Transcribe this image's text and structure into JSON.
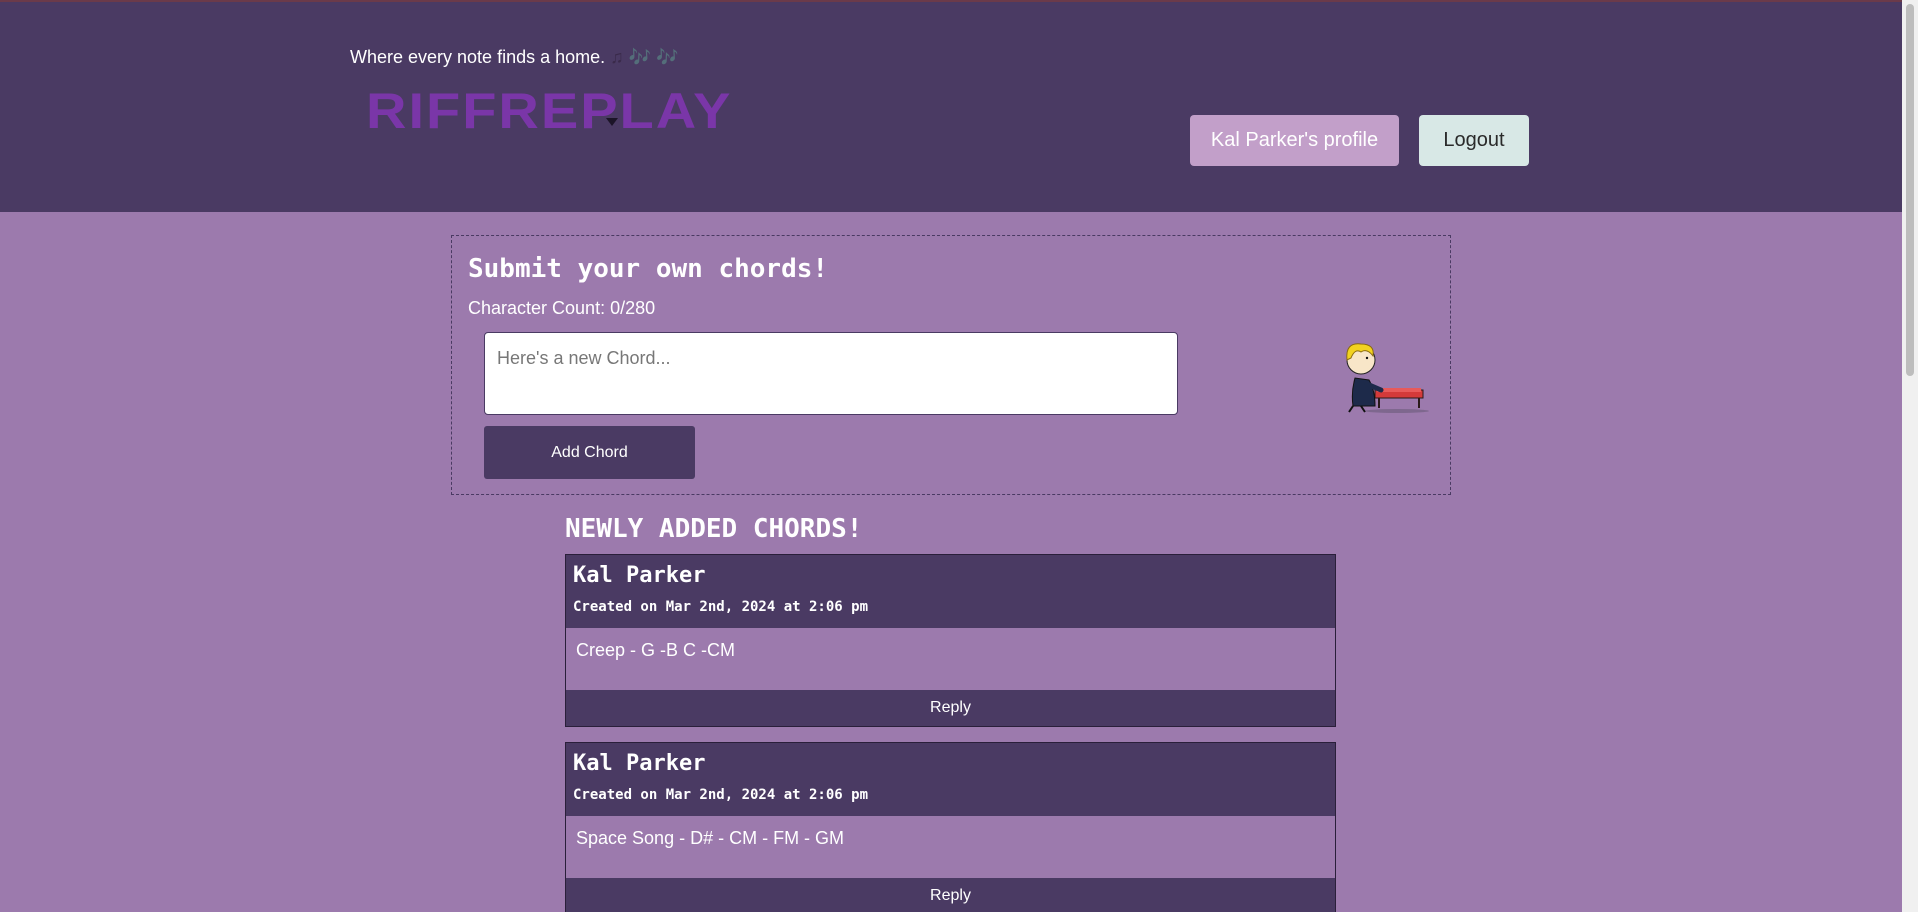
{
  "header": {
    "tagline": "Where every note finds a home.",
    "tagline_notes": "♫ 🎶 🎶",
    "logo_text": "RIFFREPLAY",
    "profile_button": "Kal Parker's profile",
    "logout_button": "Logout"
  },
  "submit": {
    "title": "Submit your own chords!",
    "char_count": "Character Count: 0/280",
    "input_placeholder": "Here's a new Chord...",
    "input_value": "",
    "add_button": "Add Chord"
  },
  "feed": {
    "title": "NEWLY ADDED CHORDS!",
    "posts": [
      {
        "author": "Kal Parker",
        "date": "Created on Mar 2nd, 2024 at 2:06 pm",
        "text": "Creep - G -B C -CM",
        "reply_label": "Reply"
      },
      {
        "author": "Kal Parker",
        "date": "Created on Mar 2nd, 2024 at 2:06 pm",
        "text": "Space Song - D# - CM - FM - GM",
        "reply_label": "Reply"
      }
    ]
  },
  "colors": {
    "header_bg": "#4a3a63",
    "page_bg": "#9c7aad",
    "logo": "#7a36a8",
    "profile_btn": "#c29fc9",
    "logout_btn": "#d8e8e6"
  }
}
